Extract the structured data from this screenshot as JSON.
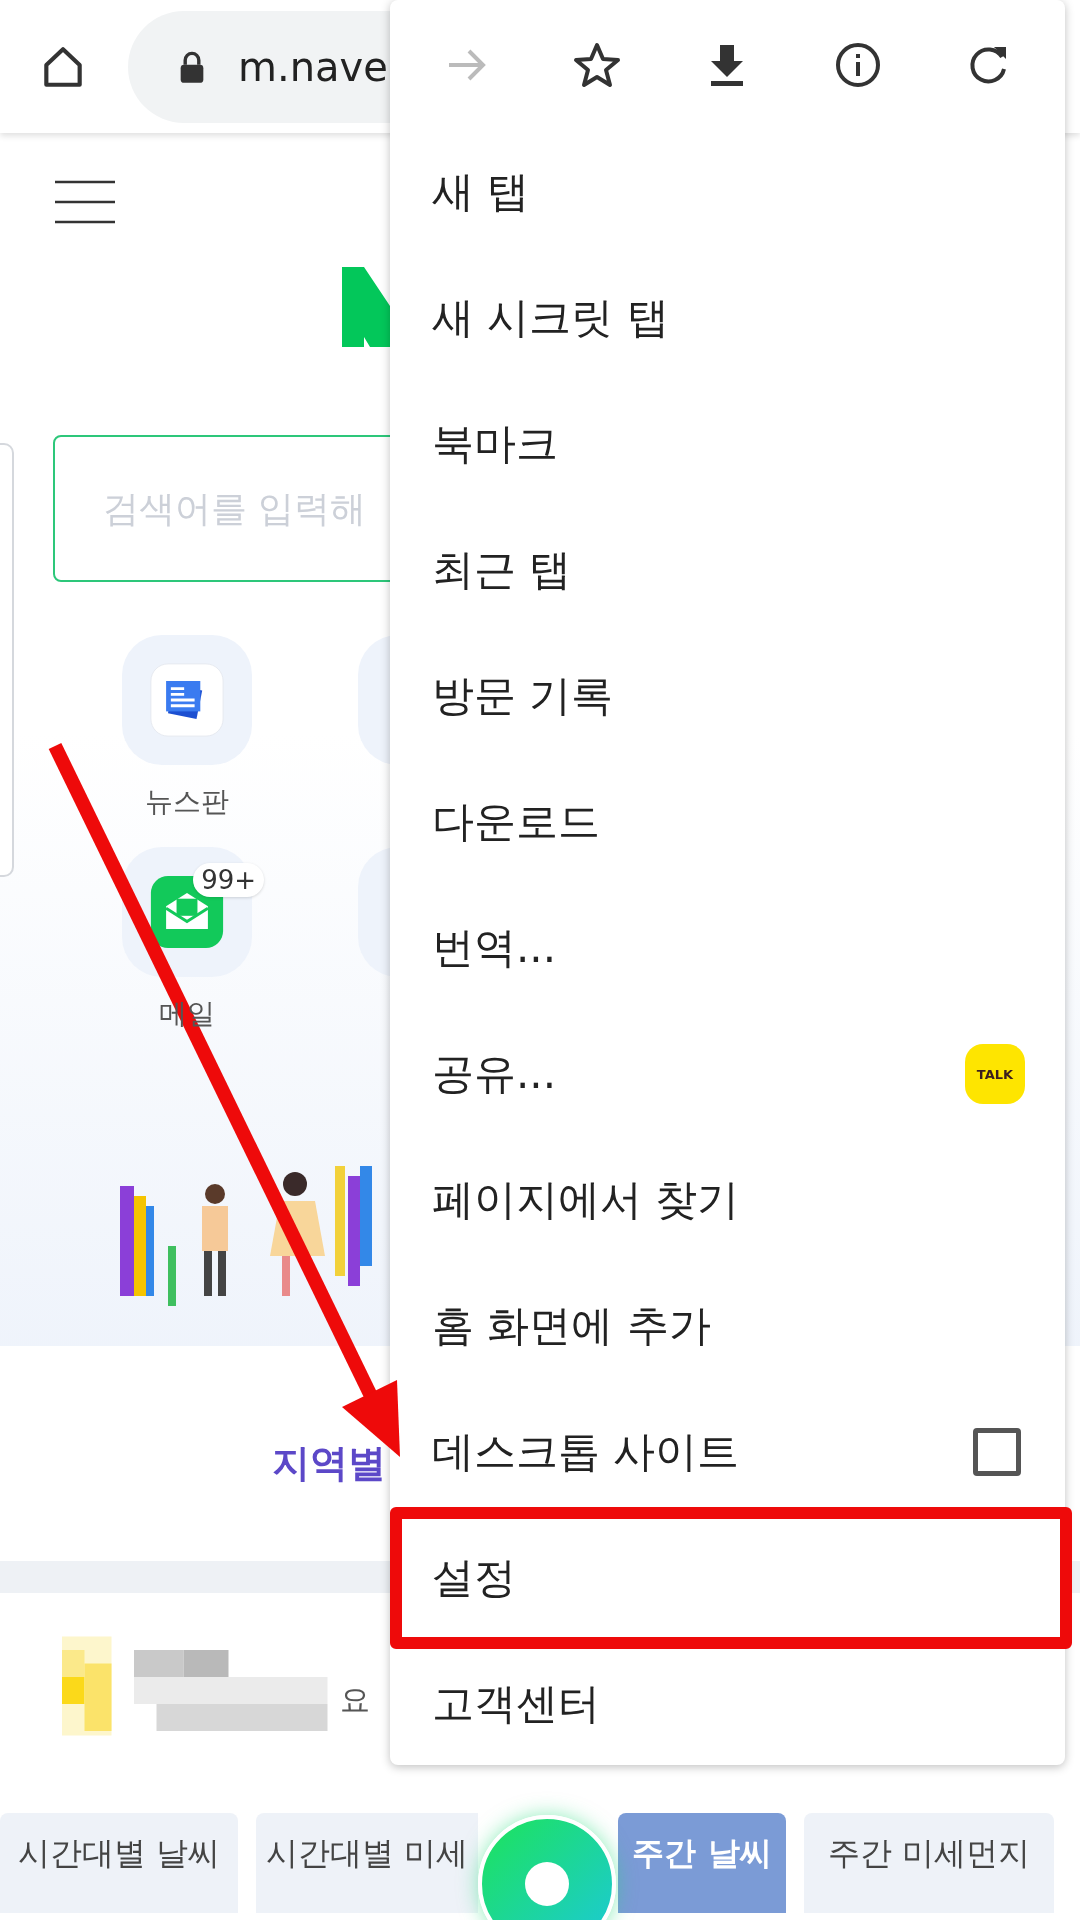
{
  "browser": {
    "url": "m.nave"
  },
  "page": {
    "search": {
      "placeholder": "검색어를 입력해"
    },
    "shortcuts": [
      {
        "label": "뉴스판",
        "kind": "news"
      },
      {
        "kind": "plain"
      },
      {
        "label": "메일",
        "kind": "mail",
        "badge": "99+"
      },
      {
        "kind": "plain"
      }
    ],
    "section_tab": "지역별",
    "weather_text": "요",
    "weather_tabs": [
      {
        "label": "시간대별 날씨",
        "selected": false
      },
      {
        "label": "시간대별 미세",
        "selected": false
      },
      {
        "label": "주간 날씨",
        "selected": true
      },
      {
        "label": "주간 미세먼지",
        "selected": false
      }
    ]
  },
  "menu": {
    "toolbar": [
      {
        "kind": "forward",
        "disabled": true
      },
      {
        "kind": "star",
        "disabled": false
      },
      {
        "kind": "download",
        "disabled": false
      },
      {
        "kind": "info",
        "disabled": false
      },
      {
        "kind": "refresh",
        "disabled": false
      }
    ],
    "items": [
      {
        "label": "새 탭",
        "kind": "plain",
        "highlighted": false
      },
      {
        "label": "새 시크릿 탭",
        "kind": "plain",
        "highlighted": false
      },
      {
        "label": "북마크",
        "kind": "plain",
        "highlighted": false
      },
      {
        "label": "최근 탭",
        "kind": "plain",
        "highlighted": false
      },
      {
        "label": "방문 기록",
        "kind": "plain",
        "highlighted": false
      },
      {
        "label": "다운로드",
        "kind": "plain",
        "highlighted": false
      },
      {
        "label": "번역...",
        "kind": "plain",
        "highlighted": false
      },
      {
        "label": "공유...",
        "kind": "share",
        "badge": "TALK",
        "highlighted": false
      },
      {
        "label": "페이지에서 찾기",
        "kind": "plain",
        "highlighted": false
      },
      {
        "label": "홈 화면에 추가",
        "kind": "plain",
        "highlighted": false
      },
      {
        "label": "데스크톱 사이트",
        "kind": "checkbox",
        "checked": false,
        "highlighted": false
      },
      {
        "label": "설정",
        "kind": "plain",
        "highlighted": true
      },
      {
        "label": "고객센터",
        "kind": "plain",
        "highlighted": false
      }
    ]
  }
}
